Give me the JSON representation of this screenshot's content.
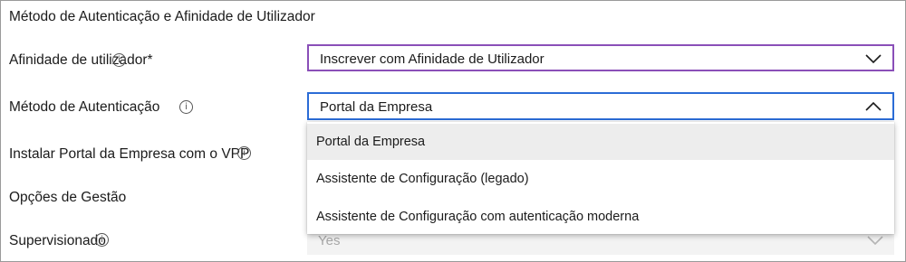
{
  "section": {
    "title": "Método de Autenticação e Afinidade de Utilizador"
  },
  "fields": {
    "affinity": {
      "label": "Afinidade de utilizador*",
      "value": "Inscrever com Afinidade de Utilizador"
    },
    "auth_method": {
      "label": "Método de Autenticação",
      "value": "Portal da Empresa",
      "options": [
        "Portal da Empresa",
        "Assistente de Configuração (legado)",
        "Assistente de Configuração com autenticação moderna"
      ]
    },
    "install_company_portal": {
      "label": "Instalar Portal da Empresa com o VPP"
    }
  },
  "management": {
    "title": "Opções de Gestão",
    "supervised": {
      "label": "Supervisionado",
      "value": "Yes"
    }
  },
  "icons": {
    "info": "info-icon",
    "chevron_down": "chevron-down-icon",
    "chevron_up": "chevron-up-icon"
  },
  "colors": {
    "affinity_border": "#8a4fb8",
    "focus_border": "#2b6cd6",
    "selected_option_bg": "#ededed",
    "disabled_bg": "#f3f3f3"
  }
}
